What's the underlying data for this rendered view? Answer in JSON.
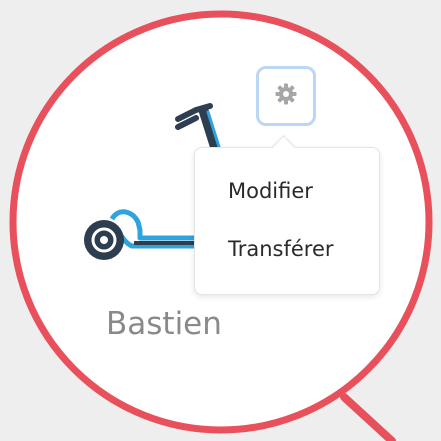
{
  "scooter": {
    "icon": "scooter-icon"
  },
  "settings_button": {
    "icon": "gear-icon"
  },
  "menu": {
    "items": [
      {
        "label": "Modifier"
      },
      {
        "label": "Transférer"
      }
    ]
  },
  "owner": {
    "name": "Bastien"
  },
  "colors": {
    "lens_border": "#e8505b",
    "button_border": "#bcd6f6",
    "scooter_blue": "#2ea3dc",
    "scooter_dark": "#2c3e50",
    "name_text": "#8a8a8a"
  }
}
